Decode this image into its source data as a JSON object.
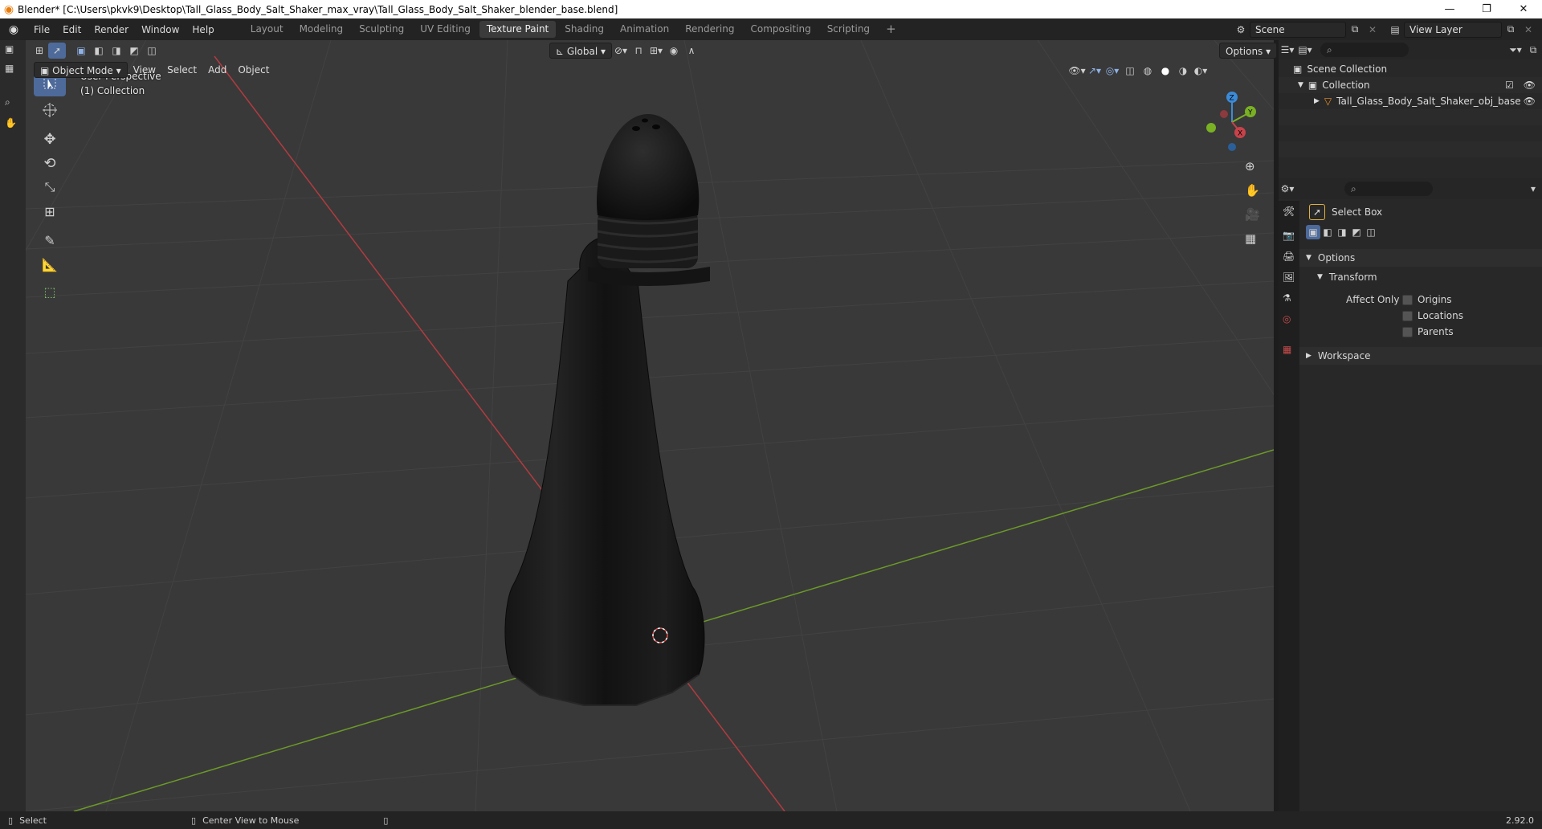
{
  "window": {
    "title": "Blender* [C:\\Users\\pkvk9\\Desktop\\Tall_Glass_Body_Salt_Shaker_max_vray\\Tall_Glass_Body_Salt_Shaker_blender_base.blend]",
    "minimize": "—",
    "maximize": "❐",
    "close": "✕"
  },
  "menu": [
    "File",
    "Edit",
    "Render",
    "Window",
    "Help"
  ],
  "workspaces": [
    {
      "label": "Layout",
      "active": false
    },
    {
      "label": "Modeling",
      "active": false
    },
    {
      "label": "Sculpting",
      "active": false
    },
    {
      "label": "UV Editing",
      "active": false
    },
    {
      "label": "Texture Paint",
      "active": true
    },
    {
      "label": "Shading",
      "active": false
    },
    {
      "label": "Animation",
      "active": false
    },
    {
      "label": "Rendering",
      "active": false
    },
    {
      "label": "Compositing",
      "active": false
    },
    {
      "label": "Scripting",
      "active": false
    }
  ],
  "add_workspace": "+",
  "scene": {
    "label": "Scene"
  },
  "view_layer": {
    "label": "View Layer"
  },
  "viewport_header": {
    "mode": "Object Mode",
    "view": "View",
    "select": "Select",
    "add": "Add",
    "object": "Object",
    "orientation": "Global",
    "options": "Options"
  },
  "viewport_overlay": {
    "perspective": "User Perspective",
    "collection": "(1) Collection"
  },
  "gizmo": {
    "z": "Z",
    "y": "Y",
    "x": "X"
  },
  "outliner": {
    "scene_collection": "Scene Collection",
    "collection": "Collection",
    "object": "Tall_Glass_Body_Salt_Shaker_obj_base"
  },
  "properties": {
    "tool_name": "Select Box",
    "options_label": "Options",
    "transform_label": "Transform",
    "affect_only": "Affect Only",
    "origins": "Origins",
    "locations": "Locations",
    "parents": "Parents",
    "workspace_label": "Workspace"
  },
  "statusbar": {
    "select": "Select",
    "center_view": "Center View to Mouse",
    "version": "2.92.0"
  },
  "colors": {
    "accent": "#4d6a9a",
    "x_axis": "#c7434a",
    "y_axis": "#7ab024",
    "z_axis": "#3b8bd9",
    "object_orange": "#e8902c"
  }
}
